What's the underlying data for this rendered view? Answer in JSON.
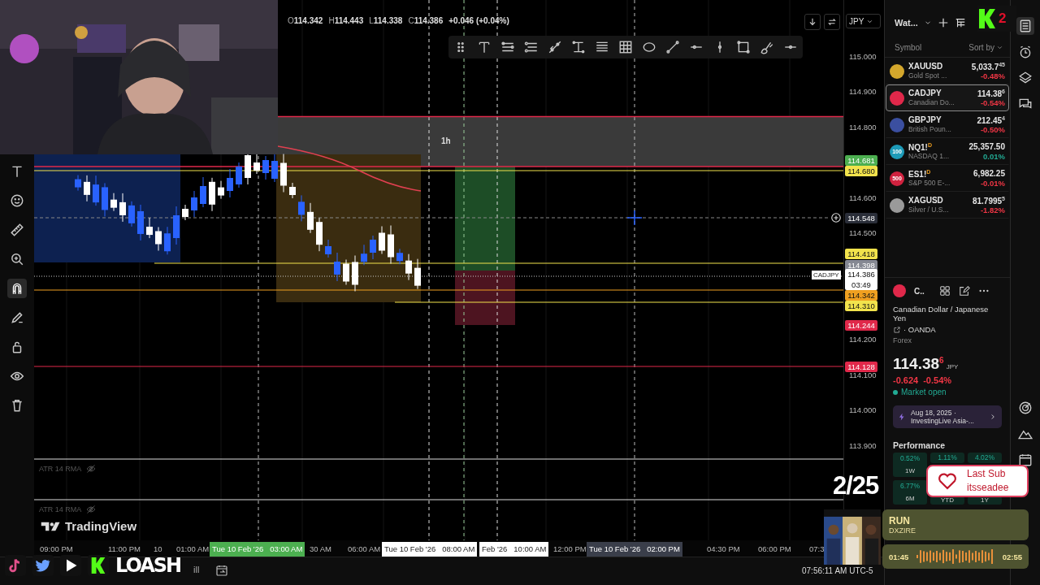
{
  "legend": {
    "items": [
      {
        "key": "O",
        "value": "114.342"
      },
      {
        "key": "H",
        "value": "114.443"
      },
      {
        "key": "L",
        "value": "114.338"
      },
      {
        "key": "C",
        "value": "114.386"
      }
    ],
    "change": "+0.046 (+0.04%)"
  },
  "chart_header": {
    "currency": "JPY"
  },
  "left_toolbar": [
    {
      "selected": false
    },
    {
      "selected": false
    },
    {
      "selected": false
    },
    {
      "selected": false
    },
    {
      "selected": true
    },
    {
      "selected": false
    },
    {
      "selected": false
    },
    {
      "selected": false
    },
    {
      "selected": false
    }
  ],
  "chart": {
    "interval_label": "1h",
    "symbol_tag": "CADJPY"
  },
  "price_axis": {
    "ticks": [
      "115.000",
      "114.900",
      "114.800",
      "114.600",
      "114.500",
      "114.200",
      "114.100",
      "114.000",
      "113.900"
    ],
    "tags": [
      {
        "price": "114.681",
        "color": "#4caf50"
      },
      {
        "price": "114.680",
        "color": "#f2e34c"
      },
      {
        "price": "114.548",
        "color": "#2a2e39"
      },
      {
        "price": "114.418",
        "color": "#f2e34c"
      },
      {
        "price": "114.398",
        "color": "#868993"
      },
      {
        "price": "114.386",
        "color": "#ffffff",
        "countdown": "03:49"
      },
      {
        "price": "114.342",
        "color": "#f0a020"
      },
      {
        "price": "114.310",
        "color": "#f2e34c"
      },
      {
        "price": "114.244",
        "color": "#e0284a"
      },
      {
        "price": "114.128",
        "color": "#e0284a"
      }
    ]
  },
  "panes": [
    {
      "title": "ATR 14 RMA",
      "hidden": true
    },
    {
      "title": "ATR 14 RMA",
      "hidden": true
    }
  ],
  "brand": "TradingView",
  "time_axis": [
    {
      "label": "09:00 PM",
      "kind": "plain"
    },
    {
      "label": "11:00 PM",
      "kind": "plain"
    },
    {
      "label": "10",
      "kind": "plain"
    },
    {
      "label": "01:00 AM",
      "kind": "plain"
    },
    {
      "label": "Tue 10 Feb '26   03:00 AM",
      "kind": "green"
    },
    {
      "label": "30 AM",
      "kind": "plain"
    },
    {
      "label": "06:00 AM",
      "kind": "plain"
    },
    {
      "label": "Tue 10 Feb '26   08:00 AM",
      "kind": "white"
    },
    {
      "label": "Feb '26   10:00 AM",
      "kind": "white"
    },
    {
      "label": "12:00 PM",
      "kind": "plain"
    },
    {
      "label": "Tue 10 Feb '26   02:00 PM",
      "kind": "gray"
    },
    {
      "label": "04:30 PM",
      "kind": "plain"
    },
    {
      "label": "06:00 PM",
      "kind": "plain"
    },
    {
      "label": "07:3",
      "kind": "plain"
    }
  ],
  "bottom_bar": {
    "fragment": "ill",
    "clock": "07:56:11 AM UTC-5"
  },
  "watchlist": {
    "title": "Wat...",
    "columns": [
      "Symbol",
      "Sort by"
    ],
    "rows": [
      {
        "symbol": "XAUUSD",
        "description": "Gold Spot ...",
        "price": "5,033.7$^{45}$",
        "change": {
          "text": "-0.48%",
          "color": "#f23645"
        },
        "selected": false,
        "color": "#d4a72c"
      },
      {
        "symbol": "CADJPY",
        "description": "Canadian Do...",
        "price": "114.38$^{6}$",
        "change": {
          "text": "-0.54%",
          "color": "#f23645"
        },
        "selected": true,
        "color": "#e0284a"
      },
      {
        "symbol": "GBPJPY",
        "description": "British Poun...",
        "price": "212.45$^{4}$",
        "change": {
          "text": "-0.50%",
          "color": "#f23645"
        },
        "selected": false,
        "color": "#3b4fa0"
      },
      {
        "symbol": "NQ1!",
        "badge": "D",
        "description": "NASDAQ 1...",
        "price": "25,357.50",
        "change": {
          "text": "0.01%",
          "color": "#22ab94"
        },
        "selected": false,
        "color": "#1e9bb8",
        "icon_text": "100"
      },
      {
        "symbol": "ES1!",
        "badge": "D",
        "description": "S&P 500 E-...",
        "price": "6,982.25",
        "change": {
          "text": "-0.01%",
          "color": "#f23645"
        },
        "selected": false,
        "color": "#d0223f",
        "icon_text": "500"
      },
      {
        "symbol": "XAGUSD",
        "description": "Silver / U.S...",
        "price": "81.7995$^{5}$",
        "change": {
          "text": "-1.82%",
          "color": "#f23645"
        },
        "selected": false,
        "color": "#9a9a9a"
      }
    ]
  },
  "details": {
    "symbol": "C..",
    "name": "Canadian Dollar / Japanese Yen",
    "exchange": "· OANDA",
    "type": "Forex",
    "price": "114.38$^{6}$",
    "currency": "JPY",
    "change": "-0.624",
    "change_percent": "-0.54%",
    "status": "Market open",
    "news": {
      "date": "Aug 18, 2025 ·",
      "headline": "InvestingLive Asia-..."
    },
    "performance": {
      "title": "Performance",
      "tiles": [
        {
          "value": "0.52%",
          "period": "1W"
        },
        {
          "value": "1.11%"
        },
        {
          "value": "4.02%"
        },
        {
          "value": "6.77%",
          "period": "6M"
        },
        {
          "period": "YTD"
        },
        {
          "period": "1Y"
        }
      ]
    }
  },
  "right_rail": [
    {
      "selected": true
    },
    {
      "selected": false
    },
    {
      "selected": false
    },
    {
      "selected": false
    },
    {
      "selected": false
    },
    {
      "selected": false
    },
    {
      "selected": false
    }
  ],
  "overlay": {
    "logo_number": "2",
    "sub_alert": {
      "title": "Last Sub",
      "name": "itsseadee"
    },
    "counter": "2/25",
    "music": {
      "title": "RUN",
      "artist": "DXZIRE",
      "elapsed": "01:45",
      "duration": "02:55"
    },
    "social": {
      "handle": "LOASH"
    }
  }
}
